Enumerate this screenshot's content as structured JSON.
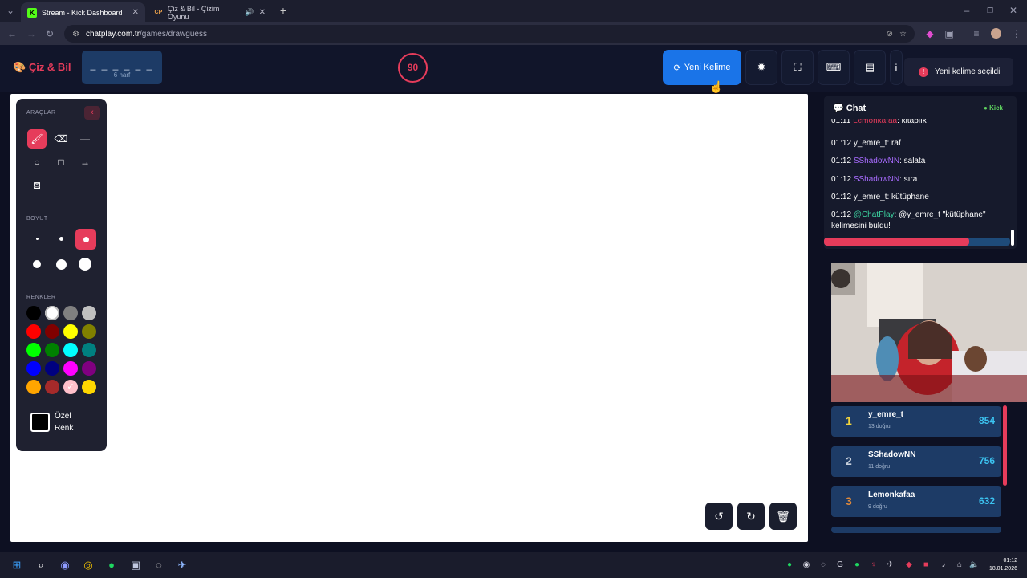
{
  "browser": {
    "tabs": [
      {
        "title": "Stream - Kick Dashboard",
        "active": true
      },
      {
        "title": "Çiz & Bil - Çizim Oyunu",
        "active": false
      }
    ],
    "url_host": "chatplay.com.tr",
    "url_path": "/games/drawguess"
  },
  "header": {
    "logo": "Çiz & Bil",
    "word_mask": "_ _ _ _ _ _",
    "word_length": "6 harf",
    "timer": "90",
    "new_word_button": "Yeni Kelime",
    "toast": "Yeni kelime seçildi",
    "buttons": [
      "settings-icon",
      "fullscreen-icon",
      "keyboard-icon",
      "archive-icon",
      "info-icon"
    ]
  },
  "tools": {
    "section_tools": "ARAÇLAR",
    "section_size": "BOYUT",
    "section_colors": "RENKLER",
    "custom_color_line1": "Özel",
    "custom_color_line2": "Renk",
    "tool_icons": [
      "brush-icon",
      "eraser-icon",
      "line-icon",
      "circle-icon",
      "rectangle-icon",
      "arrow-icon",
      "fill-icon"
    ],
    "active_tool": "brush-icon",
    "active_size_index": 2,
    "colors": [
      "#000000",
      "#ffffff",
      "#808080",
      "#c0c0c0",
      "#ff0000",
      "#800000",
      "#ffff00",
      "#808000",
      "#00ff00",
      "#008000",
      "#00ffff",
      "#008080",
      "#0000ff",
      "#000080",
      "#ff00ff",
      "#800080",
      "#ffa500",
      "#a52a2a",
      "#ffc0cb",
      "#ffd700"
    ],
    "selected_color": "#ffffff"
  },
  "chat": {
    "title": "Chat",
    "platform": "Kick",
    "messages": [
      {
        "time": "01:11",
        "user": "Lemonkafaa",
        "text": "kitaplık",
        "cls": "u-lem"
      },
      {
        "time": "01:12",
        "user": "y_emre_t",
        "text": "raf",
        "cls": "u-emr"
      },
      {
        "time": "01:12",
        "user": "SShadowNN",
        "text": "salata",
        "cls": "u-sha"
      },
      {
        "time": "01:12",
        "user": "SShadowNN",
        "text": "sıra",
        "cls": "u-sha"
      },
      {
        "time": "01:12",
        "user": "y_emre_t",
        "text": "kütüphane",
        "cls": "u-emr"
      },
      {
        "time": "01:12",
        "user": "@ChatPlay",
        "text": "@y_emre_t \"kütüphane\" kelimesini buldu!",
        "cls": "u-cp"
      }
    ],
    "progress": 0.78
  },
  "leaderboard": [
    {
      "rank": "1",
      "name": "y_emre_t",
      "sub": "13 doğru",
      "score": "854",
      "color": "#f2d43c"
    },
    {
      "rank": "2",
      "name": "SShadowNN",
      "sub": "11 doğru",
      "score": "756",
      "color": "#c8d0dc"
    },
    {
      "rank": "3",
      "name": "Lemonkafaa",
      "sub": "9 doğru",
      "score": "632",
      "color": "#e0893a"
    }
  ],
  "taskbar": {
    "time": "01:12",
    "date": "18.01.2026"
  }
}
